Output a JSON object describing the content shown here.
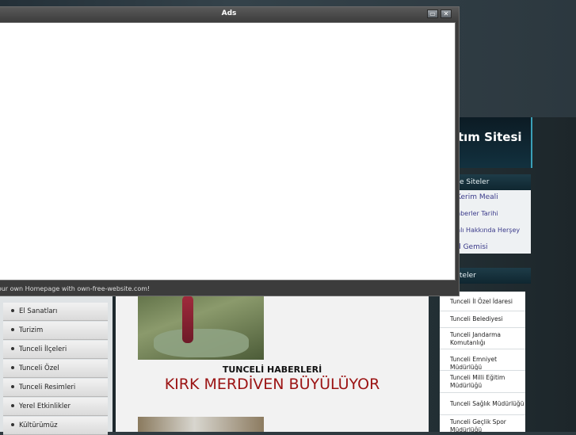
{
  "popup": {
    "title": "Ads",
    "footer_text": "Your own Homepage with own-free-website.com!",
    "restore_glyph": "▭",
    "close_glyph": "✕"
  },
  "site": {
    "title_partial": "tım Sitesi"
  },
  "right_sidebar": {
    "block1_title": "e Siteler",
    "block1_items": [
      "Kerim Meali",
      "nberler Tarihi",
      "nlı Hakkında Herşey",
      "d Gemisi"
    ],
    "block2_title": "teler",
    "block2_items": [
      "Tunceli İl Özel İdaresi",
      "Tunceli Belediyesi",
      "Tunceli Jandarma Komutanlığı",
      "Tunceli Emniyet Müdürlüğü",
      "Tunceli Milli Eğitim Müdürlüğü",
      "Tunceli Sağlık Müdürlüğü",
      "Tunceli Geçlik Spor Müdürlüğü"
    ]
  },
  "left_menu": {
    "items": [
      "El Sanatları",
      "Turizim",
      "Tunceli İlçeleri",
      "Tunceli Özel",
      "Tunceli Resimleri",
      "Yerel Etkinlikler",
      "Kültürümüz"
    ]
  },
  "main": {
    "news_heading": "TUNCELİ HABERLERİ",
    "news_title": "KIRK MERDİVEN BÜYÜLÜYOR"
  }
}
